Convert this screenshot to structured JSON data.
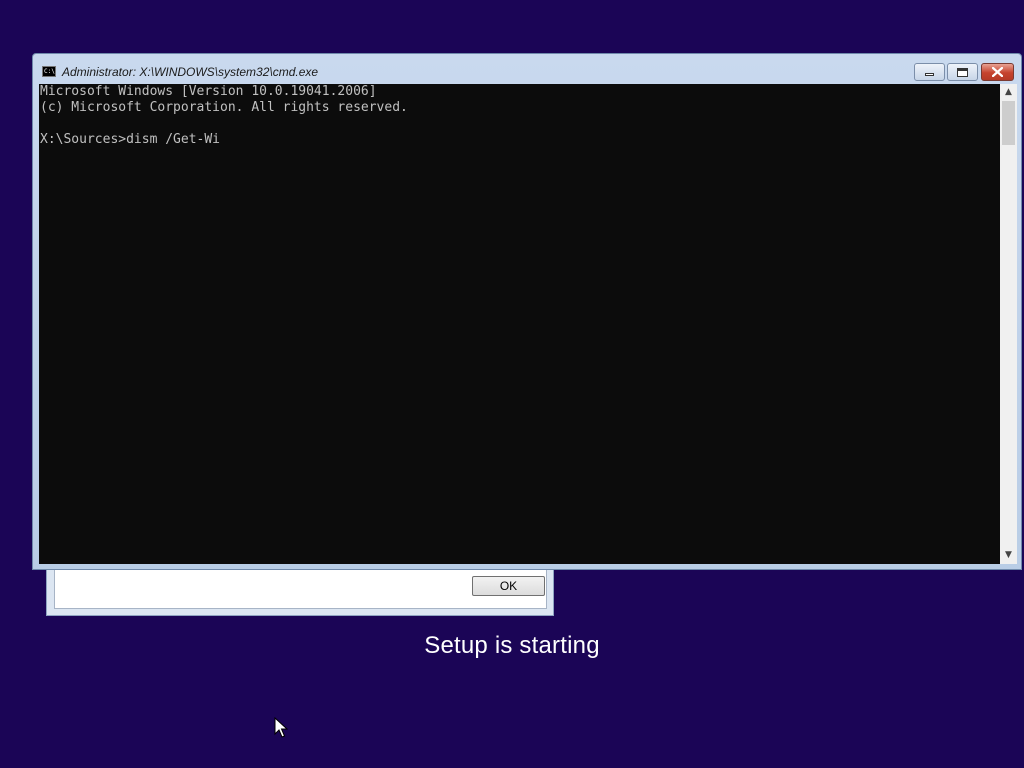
{
  "background_dialog": {
    "ok_label": "OK"
  },
  "cmd_window": {
    "title": "Administrator: X:\\WINDOWS\\system32\\cmd.exe",
    "icon_label": "C:\\",
    "console_lines": [
      "Microsoft Windows [Version 10.0.19041.2006]",
      "(c) Microsoft Corporation. All rights reserved.",
      "",
      "X:\\Sources>dism /Get-Wi"
    ]
  },
  "setup": {
    "status": "Setup is starting"
  },
  "colors": {
    "desktop_background": "#1b0556",
    "console_background": "#0c0c0c",
    "console_text": "#c0c0c0",
    "close_button": "#c6432e"
  }
}
